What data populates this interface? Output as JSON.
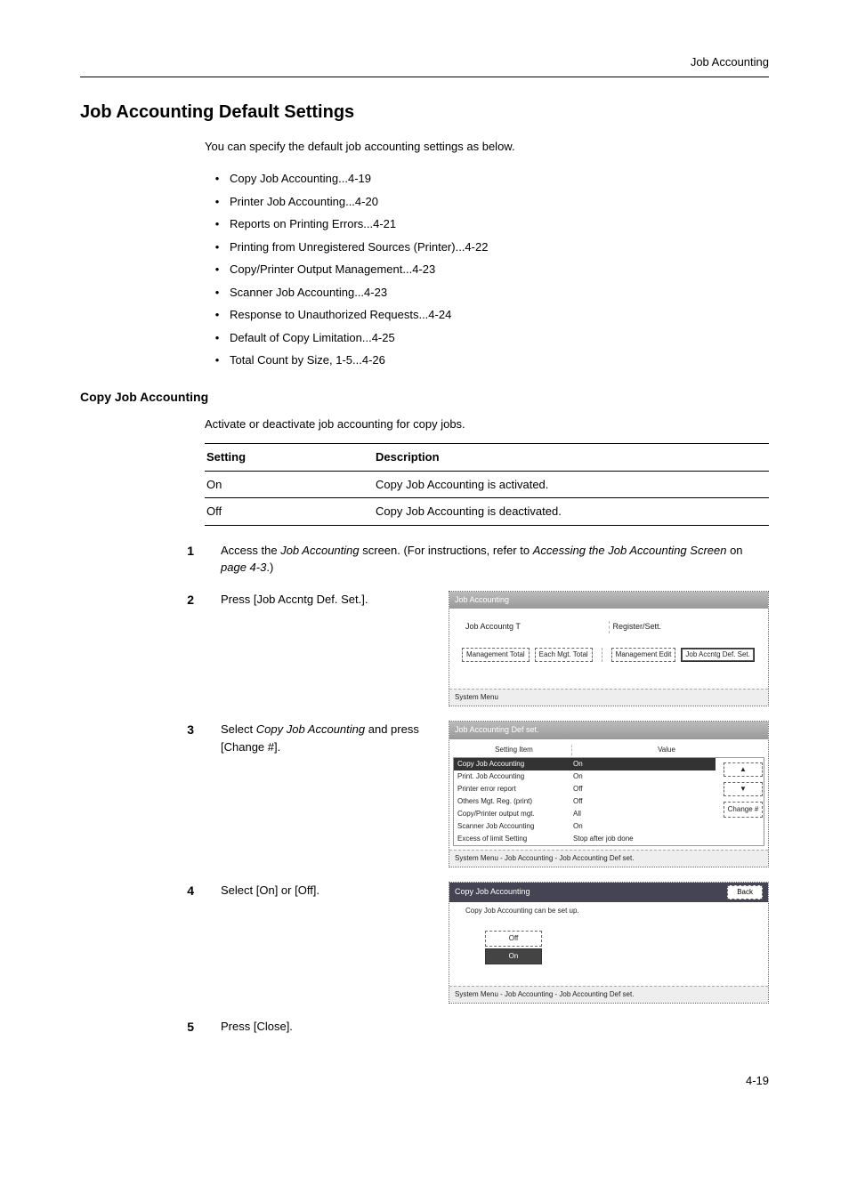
{
  "header": {
    "title": "Job Accounting"
  },
  "h1": "Job Accounting Default Settings",
  "intro": "You can specify the default job accounting settings as below.",
  "bullets": [
    "Copy Job Accounting...4-19",
    "Printer Job Accounting...4-20",
    "Reports on Printing Errors...4-21",
    "Printing from Unregistered Sources (Printer)...4-22",
    "Copy/Printer Output Management...4-23",
    "Scanner Job Accounting...4-23",
    "Response to Unauthorized Requests...4-24",
    "Default of Copy Limitation...4-25",
    "Total Count by Size, 1-5...4-26"
  ],
  "h2": "Copy Job Accounting",
  "sub_intro": "Activate or deactivate job accounting for copy jobs.",
  "table": {
    "head": {
      "c1": "Setting",
      "c2": "Description"
    },
    "rows": [
      {
        "c1": "On",
        "c2": "Copy Job Accounting is activated."
      },
      {
        "c1": "Off",
        "c2": "Copy Job Accounting is deactivated."
      }
    ]
  },
  "steps": {
    "s1": {
      "num": "1",
      "pre": "Access the ",
      "it1": "Job Accounting",
      "mid": " screen. (For instructions, refer to ",
      "it2": "Accessing the Job Accounting Screen",
      "post1": " on ",
      "it3": "page 4-3",
      "post2": ".)"
    },
    "s2": {
      "num": "2",
      "text": "Press [Job Accntg Def. Set.]."
    },
    "s3": {
      "num": "3",
      "pre": "Select ",
      "it": "Copy Job Accounting",
      "post": " and press [Change #]."
    },
    "s4": {
      "num": "4",
      "text": "Select [On] or [Off]."
    },
    "s5": {
      "num": "5",
      "text": "Press [Close]."
    }
  },
  "panel1": {
    "title": "Job Accounting",
    "left_label": "Job Accountg T",
    "right_label": "Register/Sett.",
    "btn1": "Management\nTotal",
    "btn2": "Each Mgt.\nTotal",
    "btn3": "Management\nEdit",
    "btn4": "Job Accntg\nDef. Set.",
    "footer": "System Menu"
  },
  "panel2": {
    "title": "Job Accounting Def set.",
    "col1": "Setting Item",
    "col2": "Value",
    "rows": [
      {
        "c1": "Copy Job Accounting",
        "c2": "On",
        "sel": true
      },
      {
        "c1": "Print. Job Accounting",
        "c2": "On"
      },
      {
        "c1": "Printer error report",
        "c2": "Off"
      },
      {
        "c1": "Others Mgt. Reg. (print)",
        "c2": "Off"
      },
      {
        "c1": "Copy/Printer output mgt.",
        "c2": "All"
      },
      {
        "c1": "Scanner Job Accounting",
        "c2": "On"
      },
      {
        "c1": "Excess of limit Setting",
        "c2": "Stop after job done"
      }
    ],
    "up": "▲",
    "down": "▼",
    "change": "Change #",
    "footer": "System Menu     -   Job Accounting    -   Job Accounting Def set."
  },
  "panel3": {
    "title": "Copy Job Accounting",
    "back": "Back",
    "sub": "Copy Job Accounting can be set up.",
    "off": "Off",
    "on": "On",
    "footer": "System Menu     -   Job Accounting    -   Job Accounting Def set."
  },
  "page_num": "4-19"
}
